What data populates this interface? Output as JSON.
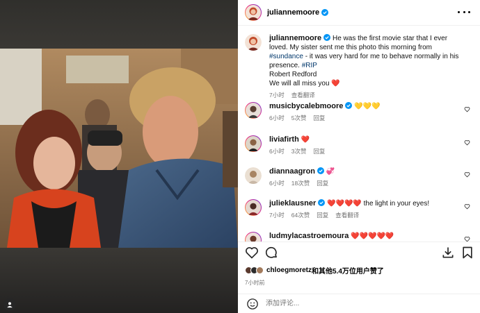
{
  "post": {
    "username": "juliannemoore",
    "caption": "He was the first movie star that I ever loved. My sister sent me this photo this morning from #sundance - it was very hard for me to behave normally in his presence. #RIP Robert Redford We will all miss you",
    "caption_parts": {
      "p1": "He was the first movie star that I ever loved. My sister sent me this photo this morning from ",
      "hashtag1": "#sundance",
      "p2": " - it was very hard for me to behave normally in his presence. ",
      "hashtag2": "#RIP",
      "line2": "Robert Redford",
      "line3": "We will all miss you",
      "emoji": "❤️"
    },
    "time": "7小时",
    "translate": "查看翻译"
  },
  "comments": [
    {
      "username": "musicbycalebmoore",
      "text": "💛💛💛",
      "time": "6小时",
      "likes": "5次赞",
      "reply": "回复"
    },
    {
      "username": "liviafirth",
      "text": "❤️",
      "time": "6小时",
      "likes": "3次赞",
      "reply": "回复"
    },
    {
      "username": "diannaagron",
      "text": "💞",
      "time": "6小时",
      "likes": "18次赞",
      "reply": "回复"
    },
    {
      "username": "julieklausner",
      "text": "❤️❤️❤️❤️ the light in your eyes!",
      "time": "7小时",
      "likes": "64次赞",
      "reply": "回复",
      "translate": "查看翻译"
    },
    {
      "username": "ludmylacastroemoura",
      "text": "❤️❤️❤️❤️❤️"
    }
  ],
  "likes_line": {
    "user": "chloegmoretz",
    "text": "和其他5.4万位用户赞了"
  },
  "post_time": "7小时前",
  "comment_placeholder": "添加评论...",
  "icons": [
    "more-icon",
    "verified-icon",
    "heart-icon",
    "comment-icon",
    "share-icon",
    "save-icon",
    "emoji-icon",
    "user-tag-icon"
  ],
  "colors": {
    "verified": "#0095f6",
    "link": "#00376b",
    "meta": "#737373"
  }
}
